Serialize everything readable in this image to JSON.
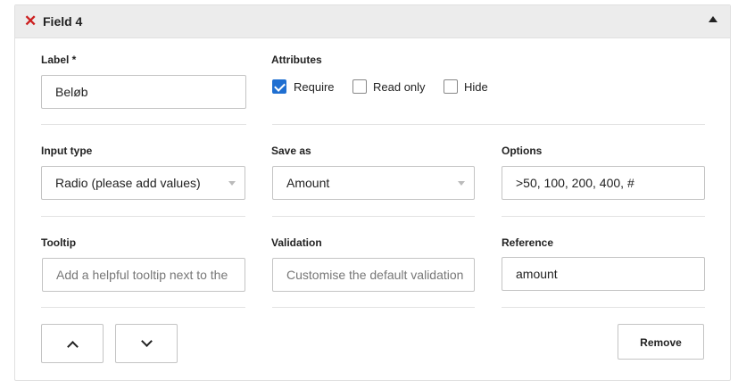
{
  "header": {
    "title": "Field 4"
  },
  "label_field": {
    "label": "Label *",
    "value": "Beløb"
  },
  "attributes": {
    "label": "Attributes",
    "items": [
      {
        "label": "Require",
        "checked": true
      },
      {
        "label": "Read only",
        "checked": false
      },
      {
        "label": "Hide",
        "checked": false
      }
    ]
  },
  "input_type": {
    "label": "Input type",
    "value": "Radio (please add values)"
  },
  "save_as": {
    "label": "Save as",
    "value": "Amount"
  },
  "options": {
    "label": "Options",
    "value": ">50, 100, 200, 400, #"
  },
  "tooltip": {
    "label": "Tooltip",
    "placeholder": "Add a helpful tooltip next to the"
  },
  "validation": {
    "label": "Validation",
    "placeholder": "Customise the default validation"
  },
  "reference": {
    "label": "Reference",
    "value": "amount"
  },
  "actions": {
    "remove_label": "Remove"
  },
  "icons": {
    "close": "close-icon",
    "collapse": "triangle-up-icon",
    "up": "chevron-up-icon",
    "down": "chevron-down-icon",
    "select": "caret-down-icon"
  },
  "colors": {
    "close": "#cc1f1f",
    "checkbox": "#1f6fd1",
    "header_bg": "#ececec"
  }
}
